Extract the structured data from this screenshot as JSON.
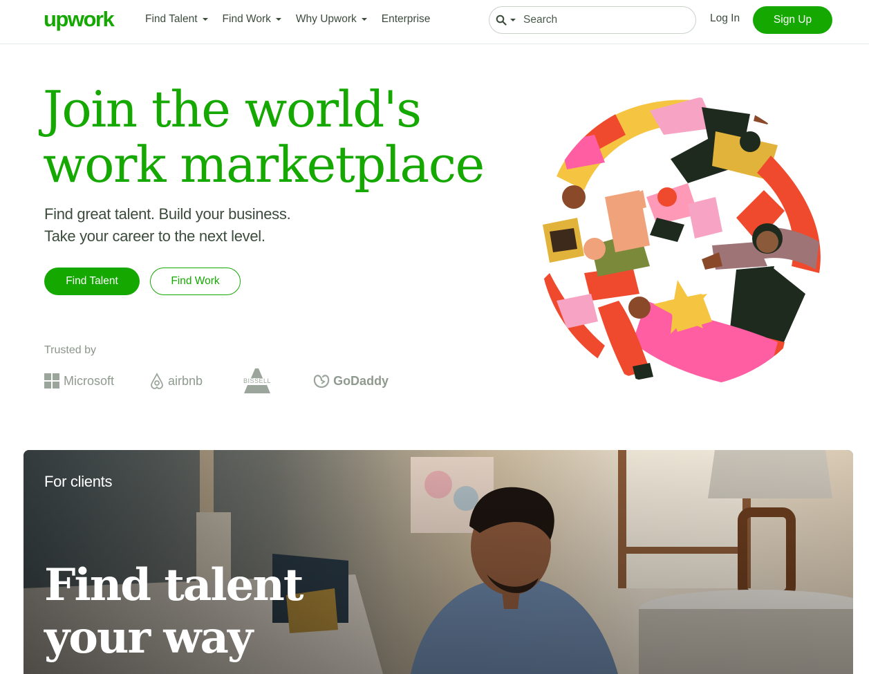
{
  "brand": {
    "logo_text": "upwork",
    "color": "#14a800"
  },
  "nav": {
    "items": [
      {
        "label": "Find Talent",
        "has_dropdown": true
      },
      {
        "label": "Find Work",
        "has_dropdown": true
      },
      {
        "label": "Why Upwork",
        "has_dropdown": true
      },
      {
        "label": "Enterprise",
        "has_dropdown": false
      }
    ]
  },
  "search": {
    "placeholder": "Search",
    "icon": "search-icon"
  },
  "auth": {
    "login_label": "Log In",
    "signup_label": "Sign Up"
  },
  "hero": {
    "title_line1": "Join the world's",
    "title_line2": "work marketplace",
    "subtitle_line1": "Find great talent. Build your business.",
    "subtitle_line2": "Take your career to the next level.",
    "primary_button": "Find Talent",
    "secondary_button": "Find Work"
  },
  "trusted": {
    "label": "Trusted by",
    "logos": [
      "Microsoft",
      "airbnb",
      "BISSELL",
      "GoDaddy"
    ]
  },
  "clients_banner": {
    "eyebrow": "For clients",
    "title_line1": "Find talent",
    "title_line2": "your way"
  }
}
